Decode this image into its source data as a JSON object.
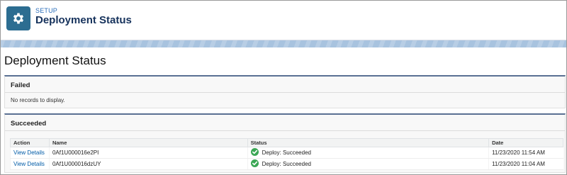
{
  "header": {
    "breadcrumb": "SETUP",
    "title": "Deployment Status"
  },
  "page": {
    "title": "Deployment Status"
  },
  "failed": {
    "title": "Failed",
    "empty_text": "No records to display."
  },
  "succeeded": {
    "title": "Succeeded",
    "columns": [
      "Action",
      "Name",
      "Status",
      "Date"
    ],
    "rows": [
      {
        "action": "View Details",
        "name": "0Af1U000016e2PI",
        "status": "Deploy: Succeeded",
        "date": "11/23/2020 11:54 AM"
      },
      {
        "action": "View Details",
        "name": "0Af1U000016dzUY",
        "status": "Deploy: Succeeded",
        "date": "11/23/2020 11:04 AM"
      }
    ]
  },
  "colors": {
    "accent": "#2c6d91",
    "section_border": "#5a7093",
    "success": "#3ba755",
    "link": "#015ba7"
  },
  "icons": {
    "setup": "gear-icon",
    "status_ok": "check-circle-icon"
  }
}
